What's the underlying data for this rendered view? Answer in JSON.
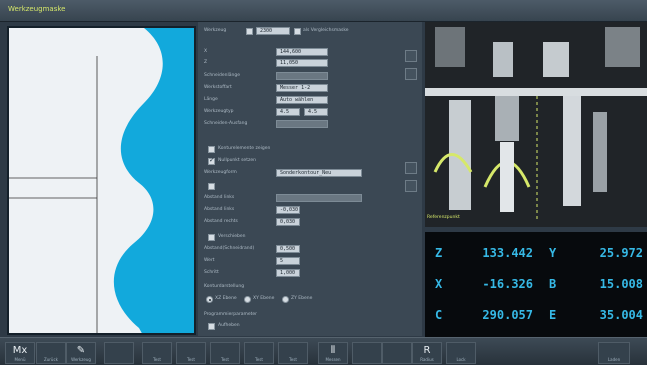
{
  "window": {
    "title": "Werkzeugmaske"
  },
  "form": {
    "top": {
      "label": "Werkzeug",
      "value": "2300",
      "label2": "als Vergleichsmaske"
    },
    "rows": [
      {
        "label": "X",
        "value": "144,600"
      },
      {
        "label": "Z",
        "value": "11,050"
      },
      {
        "label": "Schneidenlänge",
        "value": ""
      },
      {
        "label": "Werkstoffart",
        "value": "Messer 1-2"
      },
      {
        "label": "Länge",
        "value": "Auto wählen"
      },
      {
        "label": "Werkzeugtyp",
        "value": "4.5"
      },
      {
        "label": "Schneiden-Ausfang",
        "value": ""
      }
    ],
    "section2": [
      {
        "label": "Konturelemente zeigen",
        "checked": false
      },
      {
        "label": "Nullpunkt setzen",
        "checked": true
      }
    ],
    "profile_label": "Werkzeugform",
    "profile_value": "Sonderkontour_Neu",
    "more_rows": [
      {
        "label": "Abstand links",
        "value": "-0,030"
      },
      {
        "label": "Abstand rechts",
        "value": "0,030"
      },
      {
        "label": "Verschieben",
        "value": ""
      },
      {
        "label": "Abstand(Schneidrand)",
        "value": "0,500"
      },
      {
        "label": "Wert",
        "value": "5"
      },
      {
        "label": "Schritt",
        "value": "1,000"
      }
    ],
    "radio_title": "Konturdarstellung",
    "radios": [
      {
        "label": "XZ Ebene",
        "selected": true
      },
      {
        "label": "XY Ebene",
        "selected": false
      },
      {
        "label": "ZY Ebene",
        "selected": false
      }
    ],
    "bottom_title": "Programmierparameter",
    "bottom_check": "Aufheben"
  },
  "picture": {
    "label": "Referenzpunkt"
  },
  "readout": [
    {
      "axis": "Z",
      "value": "133.442",
      "axis2": "Y",
      "value2": "25.972"
    },
    {
      "axis": "X",
      "value": "-16.326",
      "axis2": "B",
      "value2": "15.008"
    },
    {
      "axis": "C",
      "value": "290.057",
      "axis2": "E",
      "value2": "35.004"
    }
  ],
  "softkeys": [
    {
      "name": "mx-key",
      "icon": "Mx",
      "label": "Menü"
    },
    {
      "name": "key-2",
      "icon": "",
      "label": "Zurück"
    },
    {
      "name": "tool-key",
      "icon": "✎",
      "label": "Werkzeug"
    },
    {
      "name": "key-4",
      "icon": "",
      "label": ""
    },
    {
      "name": "key-5",
      "icon": "",
      "label": "Test"
    },
    {
      "name": "key-6",
      "icon": "",
      "label": "Test"
    },
    {
      "name": "key-7",
      "icon": "",
      "label": "Test"
    },
    {
      "name": "key-8",
      "icon": "",
      "label": "Test"
    },
    {
      "name": "key-9",
      "icon": "",
      "label": "Test"
    },
    {
      "name": "measure-key",
      "icon": "⫴",
      "label": "Messen"
    },
    {
      "name": "key-11",
      "icon": "",
      "label": ""
    },
    {
      "name": "key-12",
      "icon": "",
      "label": ""
    },
    {
      "name": "r-key",
      "icon": "R",
      "label": "Radius"
    },
    {
      "name": "key-14",
      "icon": "",
      "label": "Lock"
    },
    {
      "name": "confirm-key",
      "icon": "",
      "label": "Laden"
    }
  ]
}
